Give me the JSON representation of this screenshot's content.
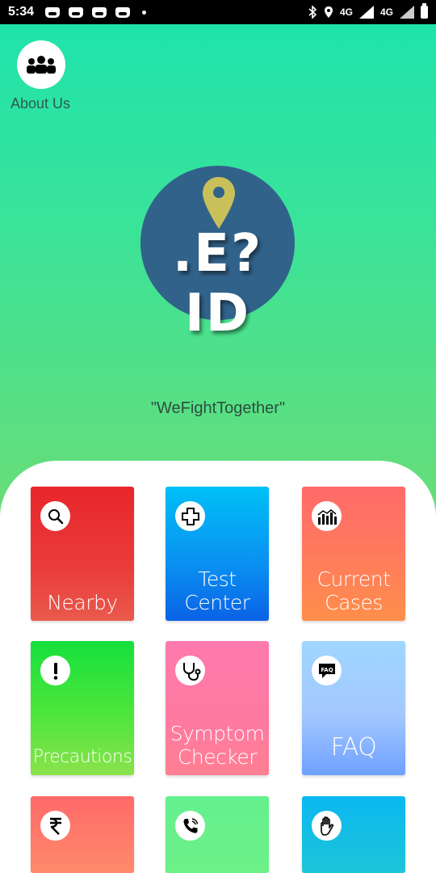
{
  "status_bar": {
    "time": "5:34",
    "net1": "4G",
    "net2": "4G"
  },
  "about": {
    "label": "About Us",
    "icon": "group-icon"
  },
  "logo": {
    "text": ".E?ID",
    "icon": "location-pin-icon"
  },
  "tagline": "\"WeFightTogether\"",
  "tiles": [
    {
      "label": "Nearby",
      "icon": "search-icon"
    },
    {
      "label": "Test\nCenter",
      "icon": "medical-cross-icon"
    },
    {
      "label": "Current\nCases",
      "icon": "bar-chart-icon"
    },
    {
      "label": "Precautions",
      "icon": "exclamation-icon"
    },
    {
      "label": "Symptom\nChecker",
      "icon": "stethoscope-icon"
    },
    {
      "label": "FAQ",
      "icon": "faq-bubble-icon"
    },
    {
      "label": "",
      "icon": "rupee-icon"
    },
    {
      "label": "",
      "icon": "phone-icon"
    },
    {
      "label": "",
      "icon": "hand-icon"
    }
  ],
  "colors": {
    "background_top": "#1ce3ad",
    "background_bottom": "#7adc6c",
    "logo_circle": "#31628a",
    "logo_pin": "#c9c05a"
  }
}
